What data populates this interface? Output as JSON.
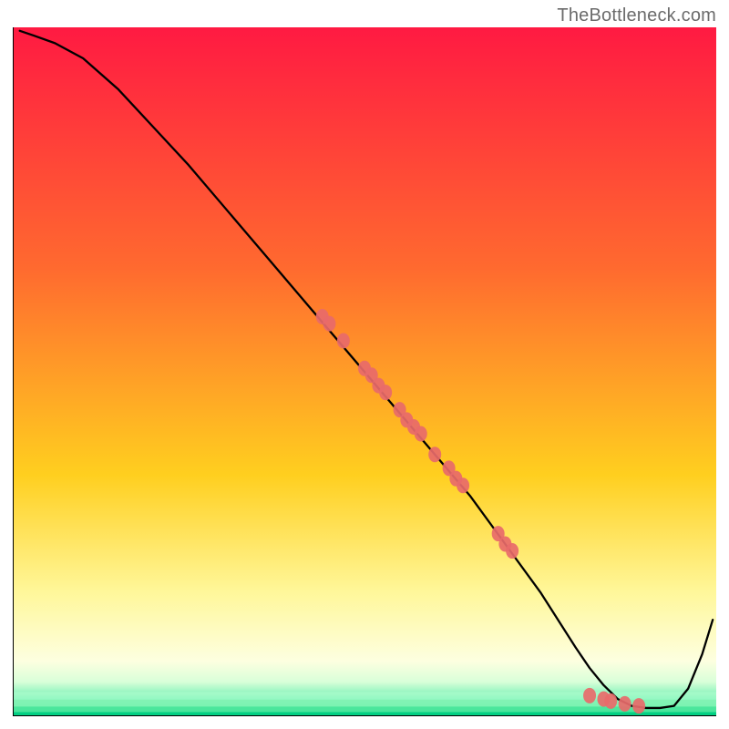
{
  "watermark": "TheBottleneck.com",
  "colors": {
    "gradient_top": "#ff1a42",
    "gradient_mid1": "#ff6a2f",
    "gradient_mid2": "#ffcf1f",
    "gradient_mid3": "#fff79a",
    "gradient_mid4": "#fdffe0",
    "gradient_bottom_band": "#d9ffd9",
    "gradient_bottom": "#00e08a",
    "curve": "#000000",
    "dot": "#e86a6a",
    "axis": "#000000"
  },
  "chart_data": {
    "type": "line",
    "title": "",
    "xlabel": "",
    "ylabel": "",
    "xlim": [
      0,
      100
    ],
    "ylim": [
      0,
      100
    ],
    "curve": {
      "x": [
        1,
        3,
        6,
        10,
        15,
        20,
        25,
        30,
        35,
        40,
        45,
        50,
        55,
        60,
        65,
        70,
        75,
        80,
        82,
        84,
        86,
        88,
        90,
        92,
        94,
        96,
        98,
        99.5
      ],
      "y": [
        99.5,
        98.8,
        97.7,
        95.5,
        91,
        85.5,
        80,
        74,
        68,
        62,
        56,
        50,
        44,
        38,
        32,
        25,
        18,
        10,
        7,
        4.5,
        2.5,
        1.5,
        1.2,
        1.2,
        1.5,
        4,
        9,
        14
      ]
    },
    "scatter": {
      "x": [
        44,
        45,
        47,
        50,
        51,
        52,
        53,
        55,
        56,
        57,
        58,
        60,
        62,
        63,
        64,
        69,
        70,
        71,
        82,
        84,
        85,
        87,
        89
      ],
      "y": [
        58,
        57,
        54.5,
        50.5,
        49.5,
        48,
        47,
        44.5,
        43,
        42,
        41,
        38,
        36,
        34.5,
        33.5,
        26.5,
        25,
        24,
        3,
        2.5,
        2.2,
        1.8,
        1.5
      ]
    },
    "green_band_y": 3.5
  }
}
